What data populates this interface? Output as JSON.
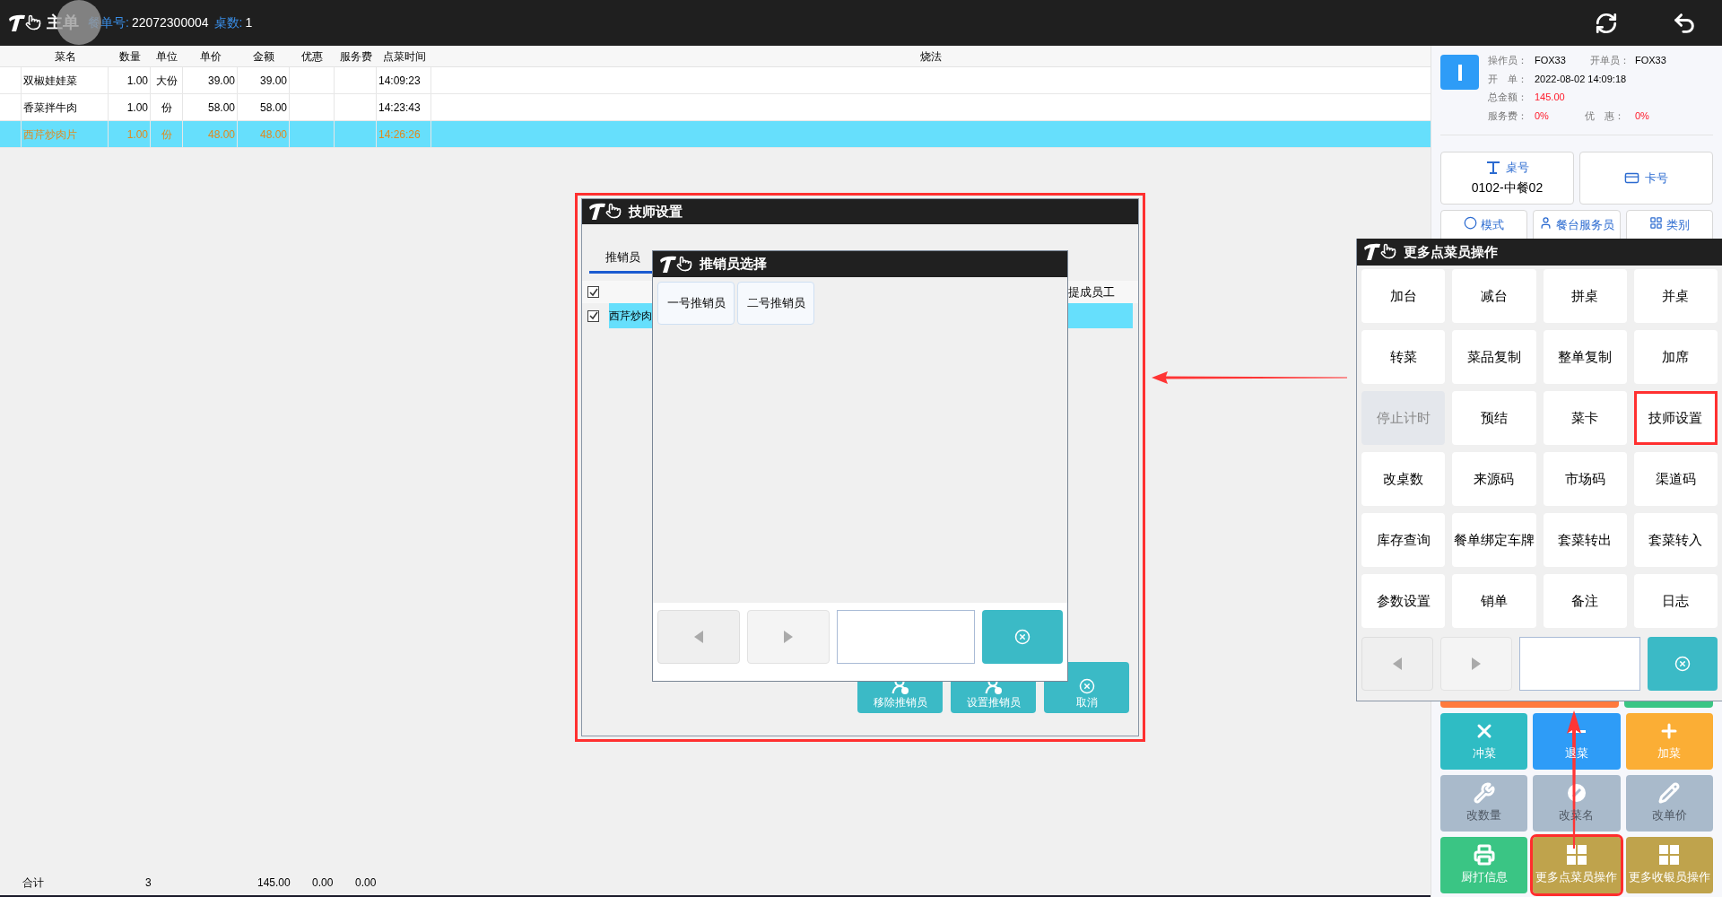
{
  "header": {
    "title": "主单",
    "order_label": "餐单号:",
    "order_no": "22072300004",
    "tables_label": "桌数:",
    "tables": "1"
  },
  "table": {
    "columns": [
      "菜名",
      "数量",
      "单位",
      "单价",
      "金额",
      "优惠",
      "服务费",
      "点菜时间",
      "烧法"
    ],
    "rows": [
      {
        "name": "双椒娃娃菜",
        "qty": "1.00",
        "unit": "大份",
        "price": "39.00",
        "amount": "39.00",
        "time": "14:09:23",
        "selected": false
      },
      {
        "name": "香菜拌牛肉",
        "qty": "1.00",
        "unit": "份",
        "price": "58.00",
        "amount": "58.00",
        "time": "14:23:43",
        "selected": false
      },
      {
        "name": "西芹炒肉片",
        "qty": "1.00",
        "unit": "份",
        "price": "48.00",
        "amount": "48.00",
        "time": "14:26:26",
        "selected": true
      }
    ]
  },
  "totals": {
    "label": "合计",
    "qty": "3",
    "amount": "145.00",
    "discount": "0.00",
    "service": "0.00"
  },
  "info": {
    "operator_label": "操作员：",
    "operator": "FOX33",
    "opener_label": "开单员：",
    "opener": "FOX33",
    "open_label": "开　单：",
    "open_time": "2022-08-02 14:09:18",
    "total_label": "总金额：",
    "total": "145.00",
    "service_label": "服务费：",
    "service": "0%",
    "discount_label": "优　惠：",
    "discount": "0%"
  },
  "table_button": {
    "label": "桌号",
    "value": "0102-中餐02"
  },
  "card_button": {
    "label": "卡号"
  },
  "small_buttons": [
    {
      "label": "模式",
      "kind": "mode"
    },
    {
      "label": "餐台服务员",
      "kind": "waiter"
    },
    {
      "label": "类别",
      "kind": "category"
    }
  ],
  "action_buttons": [
    {
      "label": "冲菜",
      "kind": "x",
      "color": "#2fbcc4",
      "disabled": false,
      "highlighted": false
    },
    {
      "label": "退菜",
      "kind": "minus",
      "color": "#2e9cf7",
      "disabled": false,
      "highlighted": false
    },
    {
      "label": "加菜",
      "kind": "plus",
      "color": "#fbae35",
      "disabled": false,
      "highlighted": false
    },
    {
      "label": "改数量",
      "kind": "wrench",
      "color": "#a9bacb",
      "disabled": true,
      "highlighted": false
    },
    {
      "label": "改菜名",
      "kind": "ban",
      "color": "#a9bacb",
      "disabled": true,
      "highlighted": false
    },
    {
      "label": "改单价",
      "kind": "pencil",
      "color": "#a9bacb",
      "disabled": true,
      "highlighted": false
    },
    {
      "label": "厨打信息",
      "kind": "printer",
      "color": "#3ac584",
      "disabled": false,
      "highlighted": false
    },
    {
      "label": "更多点菜员操作",
      "kind": "grid",
      "color": "#bfa34c",
      "disabled": false,
      "highlighted": true
    },
    {
      "label": "更多收银员操作",
      "kind": "grid",
      "color": "#bfa34c",
      "disabled": false,
      "highlighted": false
    }
  ],
  "technician_dialog": {
    "title": "技师设置",
    "highlighted": true,
    "tabs": [
      {
        "label": "推销员",
        "selected": true
      }
    ],
    "header_checked": true,
    "column": "提成员工",
    "rows": [
      {
        "name": "西芹炒肉",
        "checked": true,
        "selected": true
      }
    ],
    "buttons": [
      {
        "label": "移除推销员",
        "kind": "user"
      },
      {
        "label": "设置推销员",
        "kind": "user"
      },
      {
        "label": "取消",
        "kind": "cancel"
      }
    ]
  },
  "salesperson_dialog": {
    "title": "推销员选择",
    "options": [
      "一号推销员",
      "二号推销员"
    ]
  },
  "more_popup": {
    "title": "更多点菜员操作",
    "buttons": [
      {
        "label": "加台",
        "disabled": false,
        "highlighted": false
      },
      {
        "label": "减台",
        "disabled": false,
        "highlighted": false
      },
      {
        "label": "拼桌",
        "disabled": false,
        "highlighted": false
      },
      {
        "label": "并桌",
        "disabled": false,
        "highlighted": false
      },
      {
        "label": "转菜",
        "disabled": false,
        "highlighted": false
      },
      {
        "label": "菜品复制",
        "disabled": false,
        "highlighted": false
      },
      {
        "label": "整单复制",
        "disabled": false,
        "highlighted": false
      },
      {
        "label": "加席",
        "disabled": false,
        "highlighted": false
      },
      {
        "label": "停止计时",
        "disabled": true,
        "highlighted": false
      },
      {
        "label": "预结",
        "disabled": false,
        "highlighted": false
      },
      {
        "label": "菜卡",
        "disabled": false,
        "highlighted": false
      },
      {
        "label": "技师设置",
        "disabled": false,
        "highlighted": true
      },
      {
        "label": "改桌数",
        "disabled": false,
        "highlighted": false
      },
      {
        "label": "来源码",
        "disabled": false,
        "highlighted": false
      },
      {
        "label": "市场码",
        "disabled": false,
        "highlighted": false
      },
      {
        "label": "渠道码",
        "disabled": false,
        "highlighted": false
      },
      {
        "label": "库存查询",
        "disabled": false,
        "highlighted": false
      },
      {
        "label": "餐单绑定车牌",
        "disabled": false,
        "highlighted": false
      },
      {
        "label": "套菜转出",
        "disabled": false,
        "highlighted": false
      },
      {
        "label": "套菜转入",
        "disabled": false,
        "highlighted": false
      },
      {
        "label": "参数设置",
        "disabled": false,
        "highlighted": false
      },
      {
        "label": "销单",
        "disabled": false,
        "highlighted": false
      },
      {
        "label": "备注",
        "disabled": false,
        "highlighted": false
      },
      {
        "label": "日志",
        "disabled": false,
        "highlighted": false
      }
    ]
  }
}
